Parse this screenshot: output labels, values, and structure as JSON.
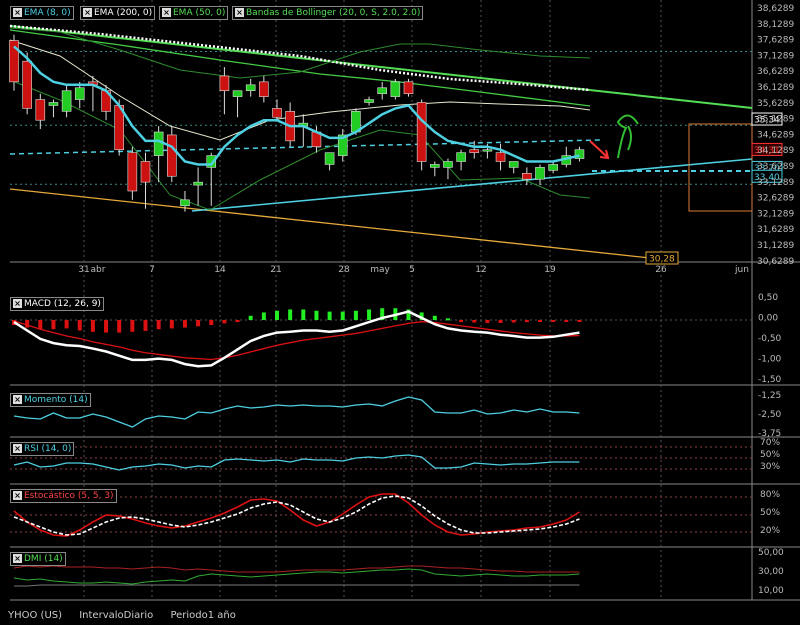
{
  "indicators_main": [
    {
      "label": "EMA (8, 0)",
      "color": "#4dd0e1"
    },
    {
      "label": "EMA (200, 0)",
      "color": "#ffffff"
    },
    {
      "label": "EMA (50, 0)",
      "color": "#55dd55"
    },
    {
      "label": "Bandas de Bollinger (20, 0, S, 2.0, 2.0)",
      "color": "#55dd55"
    }
  ],
  "panels": {
    "macd": {
      "label": "MACD (12, 26, 9)",
      "ticks": [
        "0,50",
        "0,00",
        "-0,50",
        "-1,00",
        "-1,50"
      ],
      "color": "#ffffff"
    },
    "mom": {
      "label": "Momento (14)",
      "ticks": [
        "-1,25",
        "-2,50",
        "-3,75"
      ],
      "color": "#4dd0e1"
    },
    "rsi": {
      "label": "RSI (14, 0)",
      "ticks": [
        "70%",
        "50%",
        "30%"
      ],
      "color": "#4dd0e1"
    },
    "sto": {
      "label": "Estocástico (5, 5, 3)",
      "ticks": [
        "80%",
        "50%",
        "20%"
      ],
      "color": "#ff4444"
    },
    "dmi": {
      "label": "DMI (14)",
      "ticks": [
        "50,00",
        "30,00",
        "10,00"
      ],
      "color": "#55dd55"
    }
  },
  "price_axis": [
    "38,6289",
    "38,1289",
    "37,6289",
    "37,1289",
    "36,6289",
    "36,1289",
    "35,6289",
    "35,1289",
    "34,6289",
    "34,1289",
    "33,6289",
    "33,1289",
    "32,6289",
    "32,1289",
    "31,6289",
    "31,1289",
    "30,6289"
  ],
  "price_badges": [
    {
      "text": "35,34",
      "fg": "#ffffff",
      "bg": "#000000",
      "border": "#ffffff",
      "value": 35.34
    },
    {
      "text": "34,31",
      "fg": "#ff3333",
      "bg": "#330000",
      "border": "#ff3333",
      "value": 34.31
    },
    {
      "text": "33,70",
      "fg": "#4dd0e1",
      "bg": "#000000",
      "border": "#4dd0e1",
      "value": 33.7
    },
    {
      "text": "33,40",
      "fg": "#4dd0e1",
      "bg": "#000000",
      "border": "#4dd0e1",
      "value": 33.4
    }
  ],
  "trend_label": "30,28",
  "x_labels": [
    "31",
    "abr",
    "7",
    "14",
    "21",
    "28",
    "may",
    "5",
    "12",
    "19",
    "26",
    "jun"
  ],
  "footer": {
    "symbol": "YHOO (US)",
    "interval": "IntervaloDiario",
    "period": "Periodo1 año"
  },
  "chart_data": {
    "type": "candlestick",
    "price_range": [
      30.6289,
      38.6289
    ],
    "candles": [
      {
        "o": 38.0,
        "h": 38.2,
        "l": 36.3,
        "c": 36.6
      },
      {
        "o": 37.3,
        "h": 37.6,
        "l": 35.5,
        "c": 35.7
      },
      {
        "o": 36.0,
        "h": 36.2,
        "l": 35.0,
        "c": 35.3
      },
      {
        "o": 35.8,
        "h": 36.0,
        "l": 35.4,
        "c": 35.9
      },
      {
        "o": 35.6,
        "h": 36.5,
        "l": 35.4,
        "c": 36.3
      },
      {
        "o": 36.0,
        "h": 36.6,
        "l": 35.7,
        "c": 36.4
      },
      {
        "o": 36.6,
        "h": 36.8,
        "l": 35.6,
        "c": 36.5
      },
      {
        "o": 36.3,
        "h": 36.5,
        "l": 35.3,
        "c": 35.6
      },
      {
        "o": 35.8,
        "h": 36.0,
        "l": 34.1,
        "c": 34.3
      },
      {
        "o": 34.2,
        "h": 34.4,
        "l": 32.6,
        "c": 32.9
      },
      {
        "o": 33.9,
        "h": 34.2,
        "l": 32.3,
        "c": 33.2
      },
      {
        "o": 34.1,
        "h": 35.1,
        "l": 33.2,
        "c": 34.9
      },
      {
        "o": 34.8,
        "h": 35.1,
        "l": 33.2,
        "c": 33.4
      },
      {
        "o": 32.4,
        "h": 32.9,
        "l": 32.2,
        "c": 32.6
      },
      {
        "o": 33.1,
        "h": 33.7,
        "l": 32.4,
        "c": 33.2
      },
      {
        "o": 33.7,
        "h": 34.2,
        "l": 32.4,
        "c": 34.1
      },
      {
        "o": 36.8,
        "h": 37.1,
        "l": 35.5,
        "c": 36.3
      },
      {
        "o": 36.1,
        "h": 36.3,
        "l": 35.4,
        "c": 36.3
      },
      {
        "o": 36.3,
        "h": 36.7,
        "l": 36.1,
        "c": 36.5
      },
      {
        "o": 36.6,
        "h": 36.8,
        "l": 35.9,
        "c": 36.1
      },
      {
        "o": 35.7,
        "h": 36.0,
        "l": 35.3,
        "c": 35.4
      },
      {
        "o": 35.6,
        "h": 35.9,
        "l": 34.4,
        "c": 34.6
      },
      {
        "o": 35.1,
        "h": 35.5,
        "l": 34.4,
        "c": 35.2
      },
      {
        "o": 34.9,
        "h": 35.1,
        "l": 34.2,
        "c": 34.4
      },
      {
        "o": 33.8,
        "h": 34.2,
        "l": 33.6,
        "c": 34.2
      },
      {
        "o": 34.1,
        "h": 35.0,
        "l": 33.9,
        "c": 34.8
      },
      {
        "o": 34.9,
        "h": 35.7,
        "l": 34.8,
        "c": 35.6
      },
      {
        "o": 35.9,
        "h": 36.1,
        "l": 35.8,
        "c": 36.0
      },
      {
        "o": 36.2,
        "h": 36.6,
        "l": 36.0,
        "c": 36.4
      },
      {
        "o": 36.1,
        "h": 36.7,
        "l": 36.0,
        "c": 36.6
      },
      {
        "o": 36.6,
        "h": 36.7,
        "l": 36.1,
        "c": 36.2
      },
      {
        "o": 35.9,
        "h": 36.0,
        "l": 33.6,
        "c": 33.9
      },
      {
        "o": 33.7,
        "h": 33.9,
        "l": 33.4,
        "c": 33.8
      },
      {
        "o": 33.7,
        "h": 34.0,
        "l": 33.3,
        "c": 33.9
      },
      {
        "o": 33.9,
        "h": 34.3,
        "l": 33.6,
        "c": 34.2
      },
      {
        "o": 34.3,
        "h": 34.6,
        "l": 34.0,
        "c": 34.2
      },
      {
        "o": 34.3,
        "h": 34.5,
        "l": 34.0,
        "c": 34.3
      },
      {
        "o": 34.2,
        "h": 34.5,
        "l": 33.6,
        "c": 33.9
      },
      {
        "o": 33.7,
        "h": 33.9,
        "l": 33.5,
        "c": 33.9
      },
      {
        "o": 33.5,
        "h": 33.7,
        "l": 33.1,
        "c": 33.3
      },
      {
        "o": 33.3,
        "h": 33.8,
        "l": 33.1,
        "c": 33.7
      },
      {
        "o": 33.6,
        "h": 33.9,
        "l": 33.5,
        "c": 33.8
      },
      {
        "o": 33.8,
        "h": 34.4,
        "l": 33.7,
        "c": 34.1
      },
      {
        "o": 34.0,
        "h": 34.4,
        "l": 33.9,
        "c": 34.3
      }
    ],
    "ema8": [
      37.8,
      37.4,
      36.9,
      36.6,
      36.5,
      36.5,
      36.5,
      36.3,
      35.8,
      35.1,
      34.6,
      34.6,
      34.4,
      33.9,
      33.8,
      33.8,
      34.4,
      34.8,
      35.1,
      35.3,
      35.3,
      35.1,
      35.1,
      34.9,
      34.7,
      34.7,
      34.9,
      35.2,
      35.5,
      35.7,
      35.8,
      35.3,
      34.9,
      34.6,
      34.5,
      34.4,
      34.4,
      34.3,
      34.1,
      33.9,
      33.9,
      33.9,
      34.0,
      34.1
    ],
    "macd": [
      -0.05,
      -0.25,
      -0.45,
      -0.55,
      -0.6,
      -0.62,
      -0.68,
      -0.75,
      -0.85,
      -0.95,
      -0.95,
      -0.92,
      -0.95,
      -1.05,
      -1.1,
      -1.08,
      -0.9,
      -0.7,
      -0.5,
      -0.38,
      -0.3,
      -0.28,
      -0.25,
      -0.25,
      -0.28,
      -0.25,
      -0.15,
      -0.05,
      0.05,
      0.12,
      0.2,
      0.05,
      -0.1,
      -0.2,
      -0.25,
      -0.28,
      -0.3,
      -0.35,
      -0.38,
      -0.42,
      -0.42,
      -0.4,
      -0.35,
      -0.3
    ]
  }
}
